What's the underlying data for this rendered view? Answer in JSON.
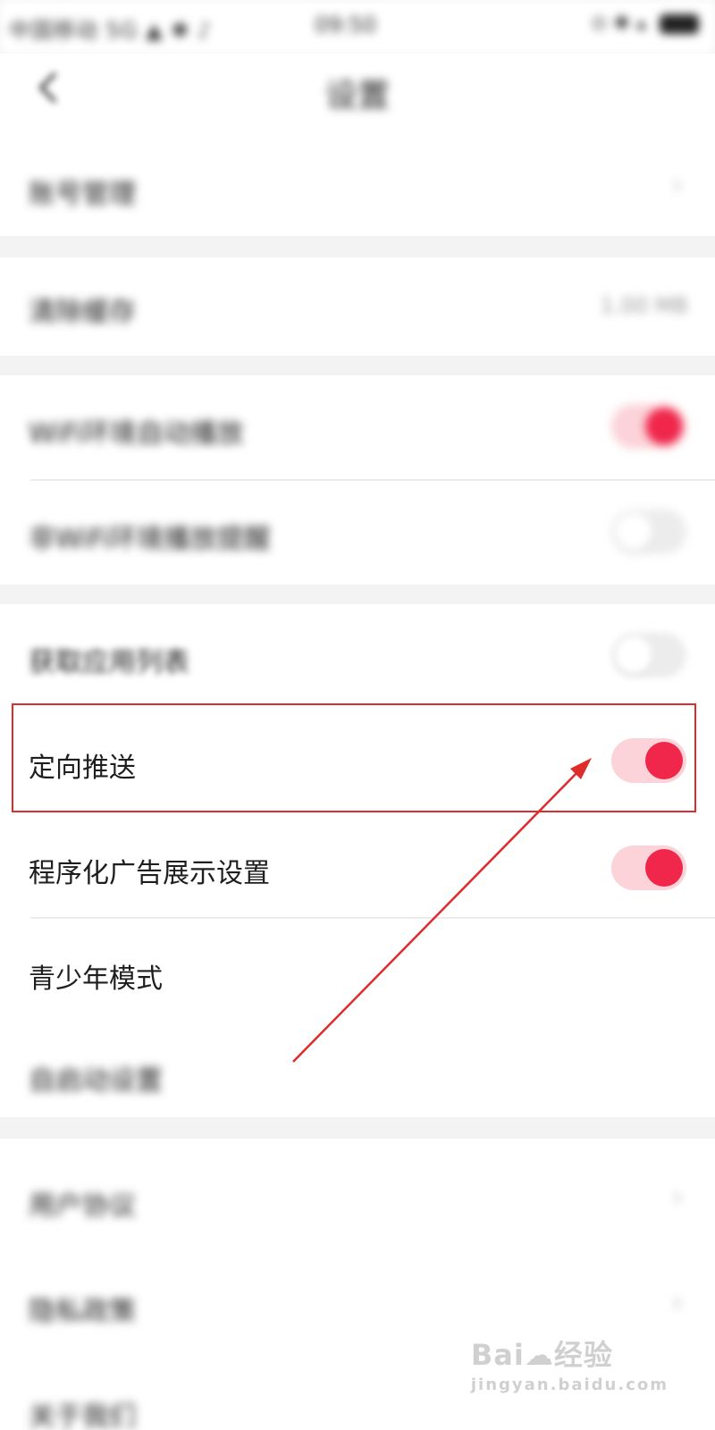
{
  "status_bar": {
    "left_text": "中国移动  5G ▲ ✱ ♪",
    "time": "09:50",
    "right_text": "⊙ ✱ ▴"
  },
  "header": {
    "title": "设置"
  },
  "rows": [
    {
      "label": "账号管理",
      "value": "",
      "control": "chevron",
      "blurred": true
    },
    {
      "label": "清除缓存",
      "value": "1.00 MB",
      "control": "value",
      "blurred": true
    },
    {
      "label": "WiFi环境自动播放",
      "control": "toggle",
      "state": "on",
      "blurred": true
    },
    {
      "label": "非WiFi环境播放提醒",
      "control": "toggle",
      "state": "off",
      "blurred": true
    },
    {
      "label": "获取应用列表",
      "control": "toggle",
      "state": "off",
      "blurred": true
    },
    {
      "label": "定向推送",
      "control": "toggle",
      "state": "on",
      "blurred": false
    },
    {
      "label": "程序化广告展示设置",
      "control": "toggle",
      "state": "on",
      "blurred": false
    },
    {
      "label": "青少年模式",
      "control": "none",
      "blurred": false
    },
    {
      "label": "自启动设置",
      "control": "none",
      "blurred": true
    },
    {
      "label": "用户协议",
      "control": "chevron",
      "blurred": true
    },
    {
      "label": "隐私政策",
      "control": "chevron",
      "blurred": true
    },
    {
      "label": "关于我们",
      "control": "none",
      "blurred": true
    }
  ],
  "watermark": {
    "logo": "Bai☁经验",
    "url": "jingyan.baidu.com"
  },
  "colors": {
    "accent": "#f0264b",
    "toggle_track_on": "#fbd3d8",
    "highlight": "#e02b2b",
    "background": "#f3f3f3"
  }
}
